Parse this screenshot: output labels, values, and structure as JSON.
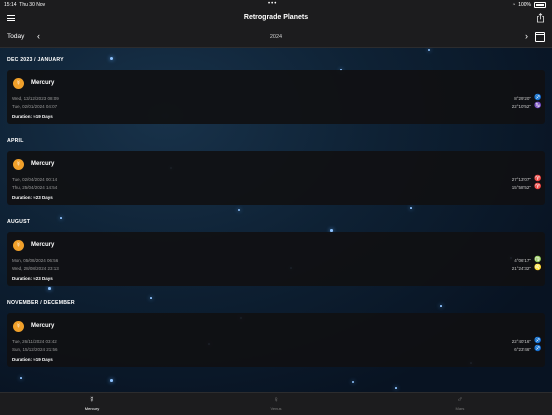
{
  "status": {
    "time": "15:14",
    "date": "Thu 30 Nov",
    "battery": "100%"
  },
  "nav": {
    "title": "Retrograde Planets",
    "menu_icon": "hamburger-menu-icon",
    "share_icon": "share-icon"
  },
  "datebar": {
    "today_label": "Today",
    "year": "2024",
    "prev_icon": "chevron-left-icon",
    "next_icon": "chevron-right-icon",
    "calendar_icon": "calendar-icon"
  },
  "sections": [
    {
      "header": "DEC 2023 / JANUARY",
      "planet": "Mercury",
      "planet_symbol": "☿",
      "start": "Wed, 13/12/2023 08:09",
      "end": "Tue, 02/01/2024 04:07",
      "duration": "Duration: ≈19 Days",
      "deg1": "8°29'20\"",
      "deg2": "22°10'52\"",
      "sign1": "♐",
      "sign2": "♑"
    },
    {
      "header": "APRIL",
      "planet": "Mercury",
      "planet_symbol": "☿",
      "start": "Tue, 02/04/2024 00:14",
      "end": "Thu, 25/04/2024 14:54",
      "duration": "Duration: ≈23 Days",
      "deg1": "27°13'07\"",
      "deg2": "15°58'52\"",
      "sign1": "♈",
      "sign2": "♈"
    },
    {
      "header": "AUGUST",
      "planet": "Mercury",
      "planet_symbol": "☿",
      "start": "Mon, 05/08/2024 06:56",
      "end": "Wed, 28/08/2024 23:13",
      "duration": "Duration: ≈23 Days",
      "deg1": "4°06'17\"",
      "deg2": "21°24'32\"",
      "sign1": "♍",
      "sign2": "♌"
    },
    {
      "header": "NOVEMBER / DECEMBER",
      "planet": "Mercury",
      "planet_symbol": "☿",
      "start": "Tue, 26/11/2024 03:42",
      "end": "Sun, 15/12/2024 21:56",
      "duration": "Duration: ≈19 Days",
      "deg1": "22°40'16\"",
      "deg2": "6°23'46\"",
      "sign1": "♐",
      "sign2": "♐"
    }
  ],
  "tabs": [
    {
      "label": "Mercury",
      "symbol": "☿",
      "active": true
    },
    {
      "label": "Venus",
      "symbol": "♀",
      "active": false
    },
    {
      "label": "Mars",
      "symbol": "♂",
      "active": false
    }
  ],
  "colors": {
    "accent": "#f0a02a",
    "sign_red": "#e03a3a",
    "bar_bg": "#1c1c1e"
  }
}
